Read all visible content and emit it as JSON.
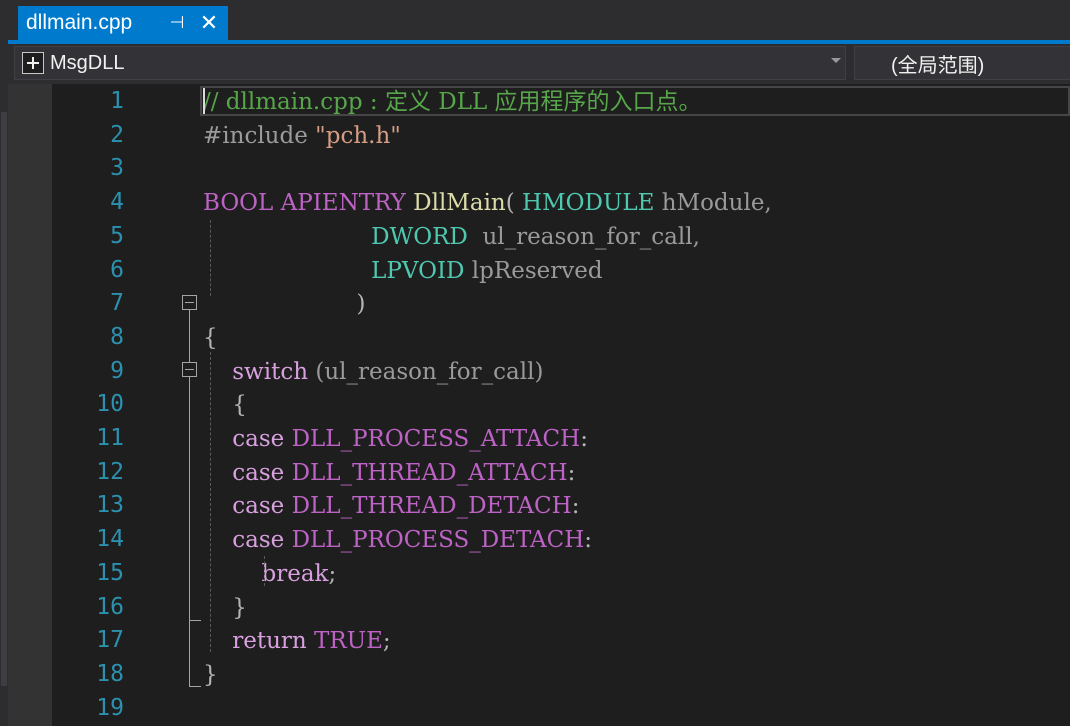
{
  "tab": {
    "title": "dllmain.cpp",
    "pin_glyph": "⊣",
    "close_glyph": "✕"
  },
  "navbar": {
    "project": "MsgDLL",
    "scope": "(全局范围)"
  },
  "colors": {
    "accent": "#007acc",
    "background": "#1e1e1e",
    "line_number": "#2b91af",
    "comment": "#57a64a",
    "type": "#4ec9b0",
    "function": "#dcdcaa",
    "keyword": "#d8a0df",
    "string": "#d69d85"
  },
  "line_numbers": [
    "1",
    "2",
    "3",
    "4",
    "5",
    "6",
    "7",
    "8",
    "9",
    "10",
    "11",
    "12",
    "13",
    "14",
    "15",
    "16",
    "17",
    "18",
    "19"
  ],
  "code": [
    [
      {
        "t": "// dllmain.cpp : 定义 DLL 应用程序的入口点。",
        "k": "comment"
      }
    ],
    [
      {
        "t": "#include ",
        "k": "preproc"
      },
      {
        "t": "\"pch.h\"",
        "k": "string"
      }
    ],
    [],
    [
      {
        "t": "BOOL APIENTRY ",
        "k": "macro"
      },
      {
        "t": "DllMain",
        "k": "func"
      },
      {
        "t": "( ",
        "k": "punct"
      },
      {
        "t": "HMODULE",
        "k": "type"
      },
      {
        "t": " hModule,",
        "k": "param"
      }
    ],
    [
      {
        "t": "                       ",
        "k": "plain"
      },
      {
        "t": "DWORD",
        "k": "type"
      },
      {
        "t": "  ul_reason_for_call,",
        "k": "param"
      }
    ],
    [
      {
        "t": "                       ",
        "k": "plain"
      },
      {
        "t": "LPVOID",
        "k": "type"
      },
      {
        "t": " lpReserved",
        "k": "param"
      }
    ],
    [
      {
        "t": "                     )",
        "k": "punct"
      }
    ],
    [
      {
        "t": "{",
        "k": "punct"
      }
    ],
    [
      {
        "t": "    ",
        "k": "plain"
      },
      {
        "t": "switch",
        "k": "keyword"
      },
      {
        "t": " (ul_reason_for_call)",
        "k": "param"
      }
    ],
    [
      {
        "t": "    {",
        "k": "punct"
      }
    ],
    [
      {
        "t": "    ",
        "k": "plain"
      },
      {
        "t": "case",
        "k": "keyword"
      },
      {
        "t": " DLL_PROCESS_ATTACH",
        "k": "macro"
      },
      {
        "t": ":",
        "k": "punct"
      }
    ],
    [
      {
        "t": "    ",
        "k": "plain"
      },
      {
        "t": "case",
        "k": "keyword"
      },
      {
        "t": " DLL_THREAD_ATTACH",
        "k": "macro"
      },
      {
        "t": ":",
        "k": "punct"
      }
    ],
    [
      {
        "t": "    ",
        "k": "plain"
      },
      {
        "t": "case",
        "k": "keyword"
      },
      {
        "t": " DLL_THREAD_DETACH",
        "k": "macro"
      },
      {
        "t": ":",
        "k": "punct"
      }
    ],
    [
      {
        "t": "    ",
        "k": "plain"
      },
      {
        "t": "case",
        "k": "keyword"
      },
      {
        "t": " DLL_PROCESS_DETACH",
        "k": "macro"
      },
      {
        "t": ":",
        "k": "punct"
      }
    ],
    [
      {
        "t": "        ",
        "k": "plain"
      },
      {
        "t": "break",
        "k": "keyword"
      },
      {
        "t": ";",
        "k": "punct"
      }
    ],
    [
      {
        "t": "    }",
        "k": "punct"
      }
    ],
    [
      {
        "t": "    ",
        "k": "plain"
      },
      {
        "t": "return",
        "k": "keyword"
      },
      {
        "t": " TRUE",
        "k": "macro"
      },
      {
        "t": ";",
        "k": "punct"
      }
    ],
    [
      {
        "t": "}",
        "k": "punct"
      }
    ],
    []
  ]
}
